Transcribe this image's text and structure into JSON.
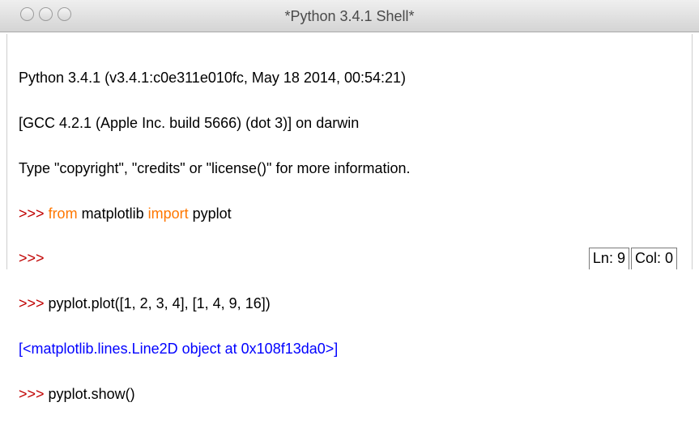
{
  "window": {
    "title": "*Python 3.4.1 Shell*"
  },
  "console": {
    "banner": [
      "Python 3.4.1 (v3.4.1:c0e311e010fc, May 18 2014, 00:54:21)",
      "[GCC 4.2.1 (Apple Inc. build 5666) (dot 3)] on darwin",
      "Type \"copyright\", \"credits\" or \"license()\" for more information."
    ],
    "prompt": ">>>",
    "line4": {
      "kw_from": "from",
      "module": " matplotlib ",
      "kw_import": "import",
      "name": " pyplot"
    },
    "line6_code": " pyplot.plot([1, 2, 3, 4], [1, 4, 9, 16])",
    "line7_output": "[<matplotlib.lines.Line2D object at 0x108f13da0>]",
    "line8_code": " pyplot.show()"
  },
  "status": {
    "line": "Ln: 9",
    "col": "Col: 0"
  },
  "colors": {
    "prompt": "#c00000",
    "keyword": "#ff7700",
    "output": "#0000ff"
  }
}
